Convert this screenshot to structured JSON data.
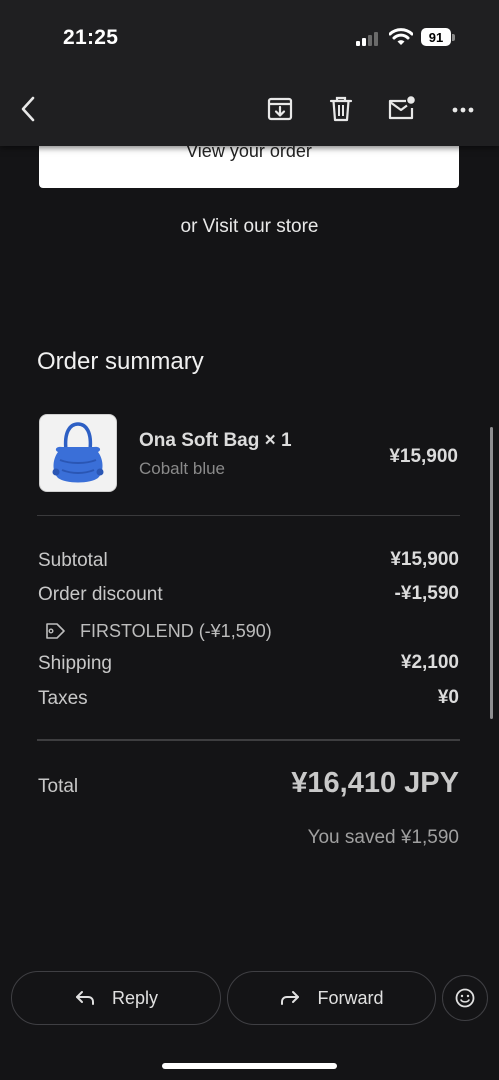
{
  "status_bar": {
    "time": "21:25",
    "battery": "91"
  },
  "toolbar": {
    "icons": [
      "back-arrow-icon",
      "archive-icon",
      "trash-icon",
      "mark-unread-icon",
      "more-icon"
    ]
  },
  "email": {
    "view_order_label": "View your order",
    "visit_store_label": "or Visit our store",
    "order_summary": {
      "title": "Order summary",
      "item": {
        "name": "Ona Soft Bag × 1",
        "variant": "Cobalt blue",
        "price": "¥15,900",
        "thumb_color": "#3a6fd8"
      },
      "subtotal_label": "Subtotal",
      "subtotal_value": "¥15,900",
      "discount_label": "Order discount",
      "discount_value": "-¥1,590",
      "discount_code": "FIRSTOLEND (-¥1,590)",
      "shipping_label": "Shipping",
      "shipping_value": "¥2,100",
      "taxes_label": "Taxes",
      "taxes_value": "¥0",
      "total_label": "Total",
      "total_value": "¥16,410 JPY",
      "saved_text": "You saved ¥1,590"
    }
  },
  "actions": {
    "reply_label": "Reply",
    "forward_label": "Forward"
  },
  "colors": {
    "background": "#141416",
    "topbar": "#1f1f21",
    "button_white": "#ffffff",
    "divider": "#3a3a3c"
  }
}
